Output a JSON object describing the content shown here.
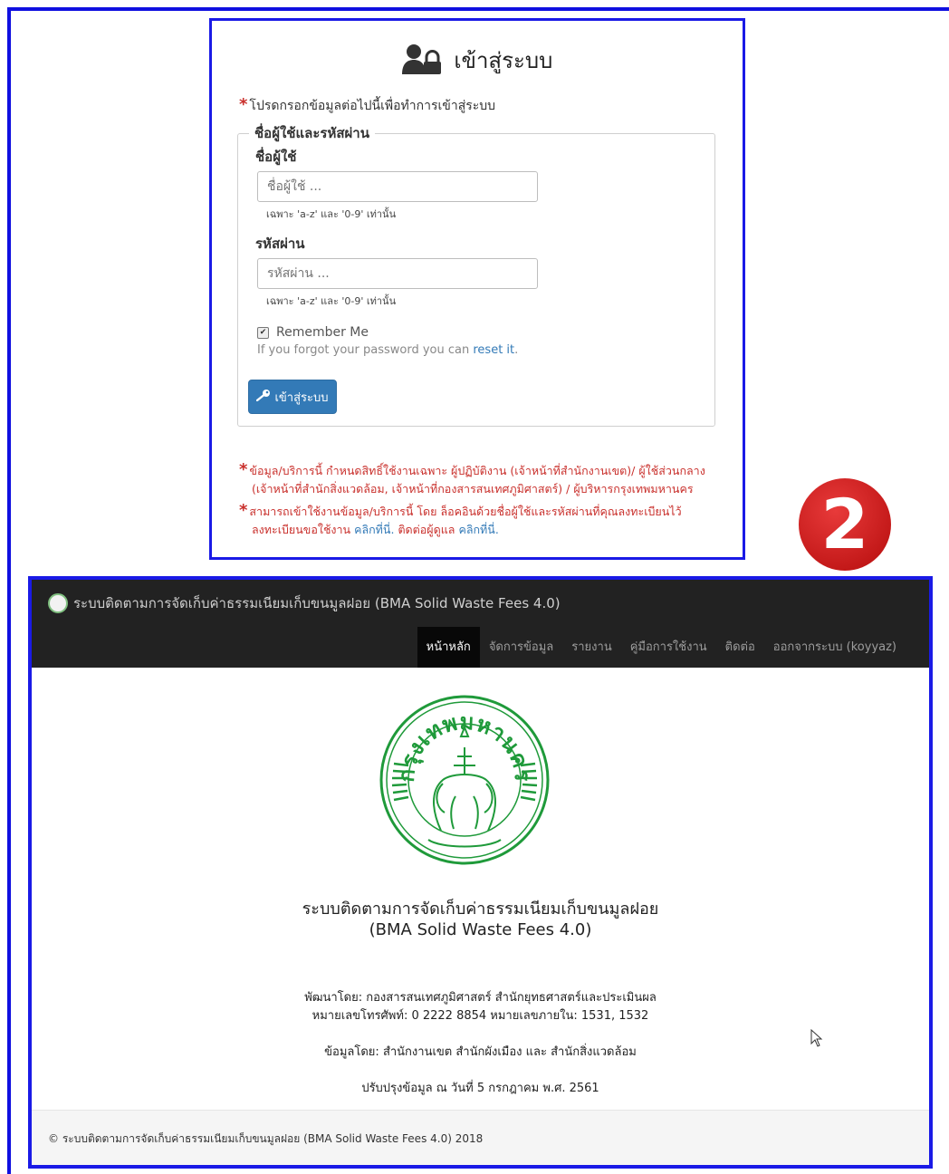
{
  "login": {
    "title": "เข้าสู่ระบบ",
    "notice": "โปรดกรอกข้อมูลต่อไปนี้เพื่อทำการเข้าสู่ระบบ",
    "fieldset_legend": "ชื่อผู้ใช้และรหัสผ่าน",
    "username_label": "ชื่อผู้ใช้",
    "username_placeholder": "ชื่อผู้ใช้ ...",
    "username_hint": "เฉพาะ 'a-z' และ '0-9' เท่านั้น",
    "password_label": "รหัสผ่าน",
    "password_placeholder": "รหัสผ่าน ...",
    "password_hint": "เฉพาะ 'a-z' และ '0-9' เท่านั้น",
    "remember_label": "Remember Me",
    "forgot_text": "If you forgot your password you can",
    "reset_link": "reset it",
    "submit_label": "เข้าสู่ระบบ",
    "note1_line1": "ข้อมูล/บริการนี้ กำหนดสิทธิ์ใช้งานเฉพาะ ผู้ปฏิบัติงาน (เจ้าหน้าที่สำนักงานเขต)/ ผู้ใช้ส่วนกลาง",
    "note1_line2": "(เจ้าหน้าที่สำนักสิ่งแวดล้อม, เจ้าหน้าที่กองสารสนเทศภูมิศาสตร์) / ผู้บริหารกรุงเทพมหานคร",
    "note2_line1": "สามารถเข้าใช้งานข้อมูล/บริการนี้ โดย ล็อคอินด้วยชื่อผู้ใช้และรหัสผ่านที่คุณลงทะเบียนไว้",
    "note2_prefix": "ลงทะเบียนขอใช้งาน",
    "note2_link1": "คลิกที่นี่.",
    "note2_middle": "ติดต่อผู้ดูแล",
    "note2_link2": "คลิกที่นี่."
  },
  "badge": "2",
  "dashboard": {
    "brand": "ระบบติดตามการจัดเก็บค่าธรรมเนียมเก็บขนมูลฝอย (BMA Solid Waste Fees 4.0)",
    "menu": [
      "หน้าหลัก",
      "จัดการข้อมูล",
      "รายงาน",
      "คู่มือการใช้งาน",
      "ติดต่อ",
      "ออกจากระบบ (koyyaz)"
    ],
    "seal_text": "กรุงเทพมหานคร",
    "title_line1": "ระบบติดตามการจัดเก็บค่าธรรมเนียมเก็บขนมูลฝอย",
    "title_line2": "(BMA Solid Waste Fees 4.0)",
    "developer": "พัฒนาโดย: กองสารสนเทศภูมิศาสตร์ สำนักยุทธศาสตร์และประเมินผล",
    "phone": "หมายเลขโทรศัพท์: 0 2222 8854 หมายเลขภายใน: 1531, 1532",
    "data_by": "ข้อมูลโดย: สำนักงานเขต สำนักผังเมือง และ สำนักสิ่งแวดล้อม",
    "updated": "ปรับปรุงข้อมูล ณ วันที่ 5 กรกฎาคม พ.ศ. 2561",
    "footer": "© ระบบติดตามการจัดเก็บค่าธรรมเนียมเก็บขนมูลฝอย (BMA Solid Waste Fees 4.0) 2018"
  },
  "colors": {
    "frame_blue": "#1a1ae6",
    "primary_button": "#337ab7",
    "notice_red": "#c9302c",
    "navbar": "#222222",
    "seal_green": "#1f9a3a"
  }
}
